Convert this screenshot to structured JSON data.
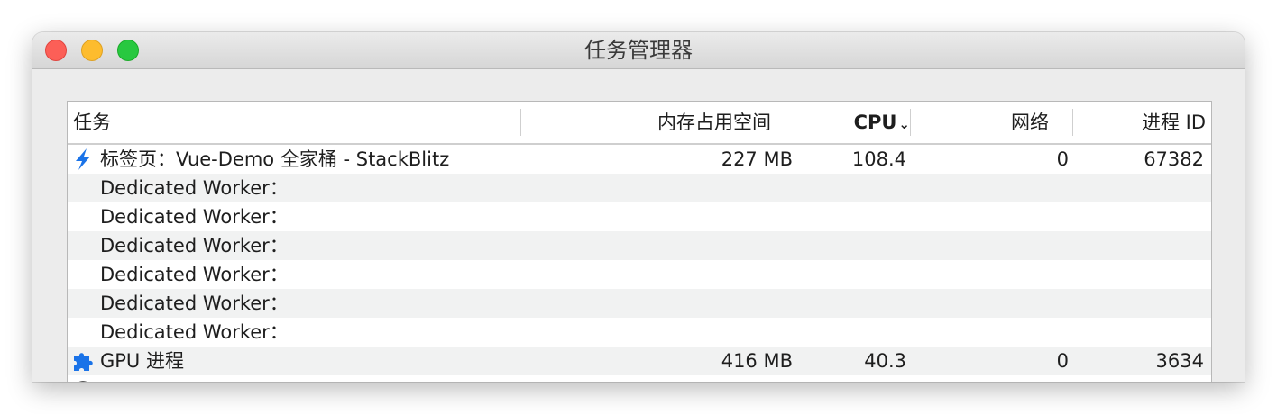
{
  "window": {
    "title": "任务管理器"
  },
  "columns": {
    "task": "任务",
    "memory": "内存占用空间",
    "cpu": "CPU",
    "network": "网络",
    "pid": "进程 ID"
  },
  "rows": [
    {
      "task": "标签页：Vue-Demo 全家桶 - StackBlitz",
      "memory": "227 MB",
      "cpu": "108.4",
      "network": "0",
      "pid": "67382",
      "icon": "lightning-bolt-icon"
    },
    {
      "task": "Dedicated Worker：",
      "memory": "",
      "cpu": "",
      "network": "",
      "pid": ""
    },
    {
      "task": "Dedicated Worker：",
      "memory": "",
      "cpu": "",
      "network": "",
      "pid": ""
    },
    {
      "task": "Dedicated Worker：",
      "memory": "",
      "cpu": "",
      "network": "",
      "pid": ""
    },
    {
      "task": "Dedicated Worker：",
      "memory": "",
      "cpu": "",
      "network": "",
      "pid": ""
    },
    {
      "task": "Dedicated Worker：",
      "memory": "",
      "cpu": "",
      "network": "",
      "pid": ""
    },
    {
      "task": "Dedicated Worker：",
      "memory": "",
      "cpu": "",
      "network": "",
      "pid": ""
    },
    {
      "task": "GPU 进程",
      "memory": "416 MB",
      "cpu": "40.3",
      "network": "0",
      "pid": "3634",
      "icon": "puzzle-piece-icon"
    }
  ],
  "sort": {
    "column": "cpu",
    "direction": "descending"
  },
  "colors": {
    "lightning": "#1a73e8",
    "puzzle": "#1a73e8",
    "alt_row": "#f1f2f2"
  }
}
